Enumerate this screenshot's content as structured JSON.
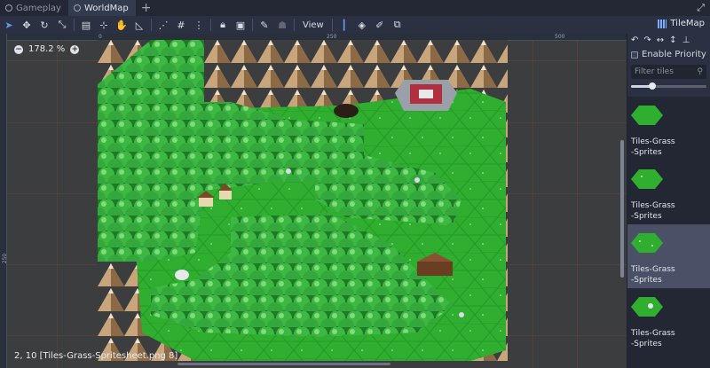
{
  "tabs": [
    {
      "label": "Gameplay",
      "active": false
    },
    {
      "label": "WorldMap",
      "active": true
    }
  ],
  "toolbar": {
    "view_label": "View",
    "right_label": "TileMap",
    "icons": [
      "select-icon",
      "move-icon",
      "rotate-icon",
      "scale-icon",
      "list-icon",
      "pivot-icon",
      "pan-icon",
      "ruler-icon",
      "smart-snap-icon",
      "grid-snap-icon",
      "more-icon",
      "lock-icon",
      "group-icon",
      "bone-icon",
      "skeleton-icon",
      "tile-icon",
      "fill-icon",
      "hand-icon",
      "copy-icon"
    ]
  },
  "viewport": {
    "zoom_label": "178.2 %",
    "ruler_marks": [
      "0",
      "250",
      "500"
    ],
    "ruler_left_mark": "250",
    "status": "2, 10 [Tiles-Grass-Spritesheet.png 8]"
  },
  "panel": {
    "enable_priority": "Enable Priority",
    "filter_placeholder": "Filter tiles",
    "slider_value": 0.3,
    "tiles": [
      {
        "label": "Tiles-Grass-Sprites",
        "selected": false
      },
      {
        "label": "Tiles-Grass-Sprites",
        "selected": false
      },
      {
        "label": "Tiles-Grass-Sprites",
        "selected": true
      },
      {
        "label": "Tiles-Grass-Sprites",
        "selected": false
      }
    ]
  },
  "colors": {
    "grass": "#2fae2f",
    "grass_dark": "#249a24",
    "tree": "#3cb843",
    "tree_dark": "#1f7a26",
    "mountain": "#c9a57b",
    "mountain_dark": "#8d6a46",
    "accent": "#5c9cf0"
  }
}
